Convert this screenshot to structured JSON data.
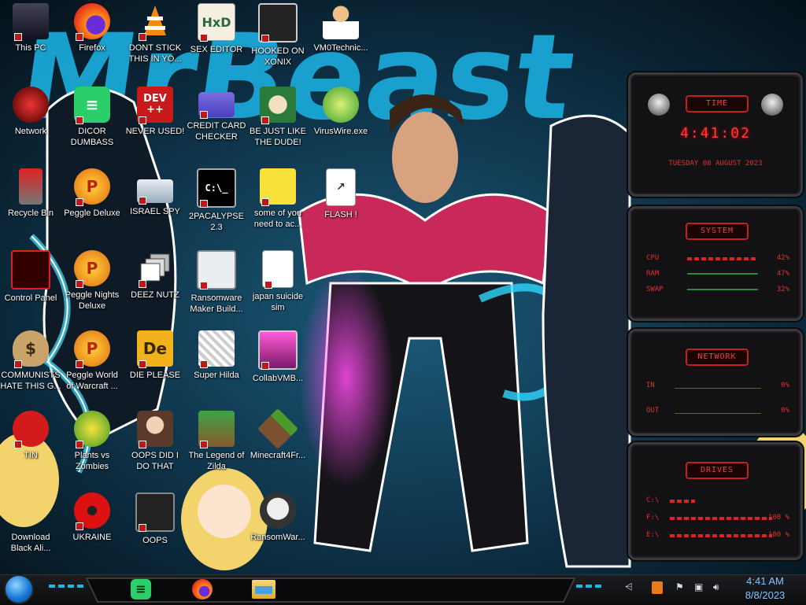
{
  "wallpaper": {
    "title_text": "MrBeast"
  },
  "desktop_icons": [
    {
      "id": "this-pc",
      "label": "This PC"
    },
    {
      "id": "firefox",
      "label": "Firefox"
    },
    {
      "id": "dont-stick",
      "label": "DONT STICK THIS IN YO..."
    },
    {
      "id": "sex-editor",
      "label": "SEX EDITOR"
    },
    {
      "id": "hooked-on-xonix",
      "label": "HOOKED ON XONIX"
    },
    {
      "id": "vm0technic",
      "label": "VM0Technic..."
    },
    {
      "id": "network",
      "label": "Network"
    },
    {
      "id": "dickord",
      "label": "DICOR DUMBASS"
    },
    {
      "id": "never-used",
      "label": "NEVER USED!"
    },
    {
      "id": "credit-card",
      "label": "CREDIT CARD CHECKER"
    },
    {
      "id": "be-just-like",
      "label": "BE JUST LIKE THE DUDE!"
    },
    {
      "id": "viruswire",
      "label": "VirusWire.exe"
    },
    {
      "id": "recycle-bin",
      "label": "Recycle Bin"
    },
    {
      "id": "peggle-deluxe",
      "label": "Peggle Deluxe"
    },
    {
      "id": "israel-spy",
      "label": "ISRAEL SPY"
    },
    {
      "id": "2pacalypse",
      "label": "2PACALYPSE 2.3"
    },
    {
      "id": "some-of-you",
      "label": "some of you need to ac..."
    },
    {
      "id": "flash",
      "label": "FLASH !"
    },
    {
      "id": "control-panel",
      "label": "Control Panel"
    },
    {
      "id": "peggle-nights",
      "label": "Peggle Nights Deluxe"
    },
    {
      "id": "deez-nutz",
      "label": "DEEZ NUTZ"
    },
    {
      "id": "ransomware-maker",
      "label": "Ransomware Maker Build..."
    },
    {
      "id": "japan-suicide",
      "label": "japan suicide sim"
    },
    {
      "id": "communists",
      "label": "COMMUNISTS HATE THIS G..."
    },
    {
      "id": "peggle-world",
      "label": "Peggle World of Warcraft ..."
    },
    {
      "id": "die-please",
      "label": "DIE PLEASE"
    },
    {
      "id": "super-hilda",
      "label": "Super Hilda"
    },
    {
      "id": "collabvmb",
      "label": "CollabVMB..."
    },
    {
      "id": "tin",
      "label": "TIN"
    },
    {
      "id": "plants-vs-zombies",
      "label": "Plants vs Zombies"
    },
    {
      "id": "oops-did-i",
      "label": "OOPS DID I DO THAT"
    },
    {
      "id": "legend-of-zilda",
      "label": "The Legend of Zilda"
    },
    {
      "id": "minecraft4fr",
      "label": "Minecraft4Fr..."
    },
    {
      "id": "download-black-ali",
      "label": "Download Black Ali..."
    },
    {
      "id": "ukraine",
      "label": "UKRAINE"
    },
    {
      "id": "oops",
      "label": "OOPS"
    },
    {
      "id": "ransomwar",
      "label": "RansomWar..."
    }
  ],
  "gadgets": {
    "time": {
      "header": "TIME",
      "clock": "4:41:02",
      "date": "TUESDAY 08 AUGUST 2023"
    },
    "system": {
      "header": "SYSTEM",
      "rows": [
        {
          "key": "CPU",
          "value": "42%",
          "level": 0.42
        },
        {
          "key": "RAM",
          "value": "47%",
          "level": 0.47
        },
        {
          "key": "SWAP",
          "value": "32%",
          "level": 0.32
        }
      ]
    },
    "network": {
      "header": "NETWORK",
      "rows": [
        {
          "key": "IN",
          "value": "0%"
        },
        {
          "key": "OUT",
          "value": "0%"
        }
      ]
    },
    "drives": {
      "header": "DRIVES",
      "rows": [
        {
          "key": "C:\\",
          "value": "",
          "level": 0.35
        },
        {
          "key": "F:\\",
          "value": "100 %",
          "level": 1.0
        },
        {
          "key": "E:\\",
          "value": "100 %",
          "level": 1.0
        }
      ]
    }
  },
  "taskbar": {
    "apps": [
      {
        "id": "spotify",
        "label": "Spotify"
      },
      {
        "id": "firefox",
        "label": "Firefox"
      },
      {
        "id": "file-explorer",
        "label": "File Explorer"
      }
    ],
    "clock_time": "4:41 AM",
    "clock_date": "8/8/2023"
  },
  "colors": {
    "accent_red": "#e23030",
    "wallpaper_cyan": "#1aa7d6",
    "clock_blue": "#7fc6ff"
  }
}
